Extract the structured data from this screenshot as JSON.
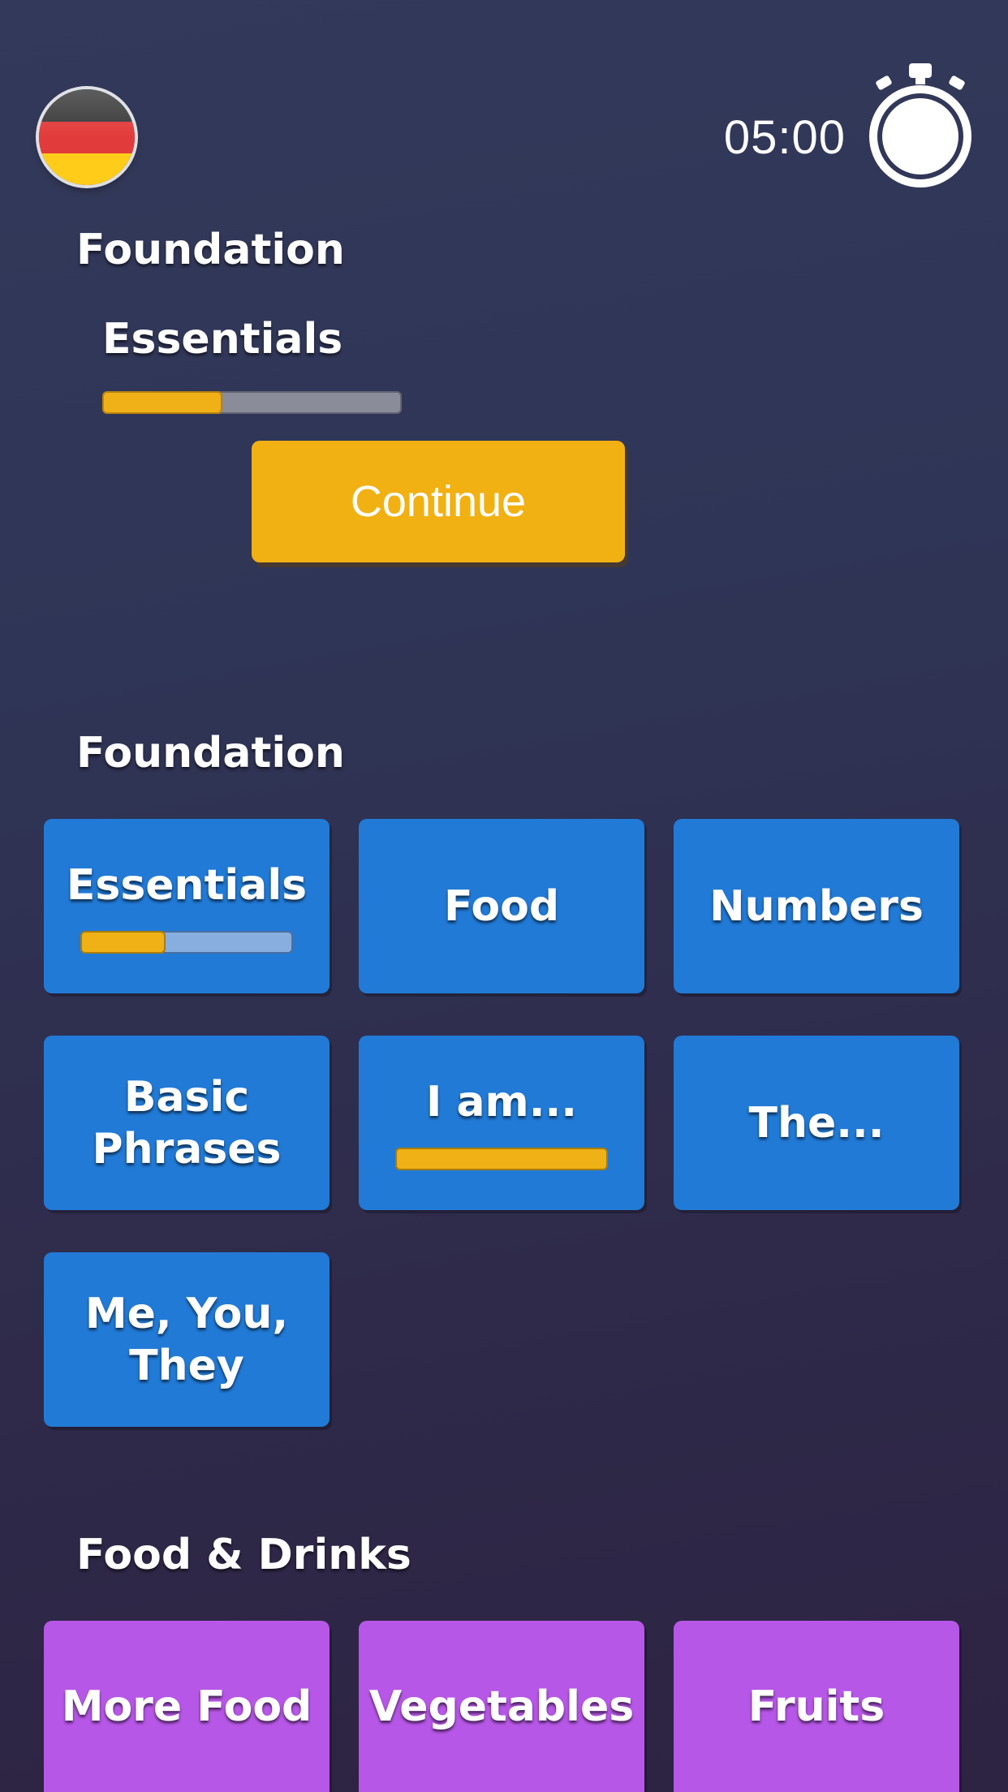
{
  "top_bar": {
    "flag_icon": "germany-flag-icon",
    "timer": "05:00",
    "timer_icon": "stopwatch-icon"
  },
  "current_lesson": {
    "section_title": "Foundation",
    "lesson_title": "Essentials",
    "progress": 0.4,
    "continue_label": "Continue"
  },
  "sections": [
    {
      "title": "Foundation",
      "color": "#217ad6",
      "tiles": [
        {
          "label": "Essentials",
          "progress": 0.4
        },
        {
          "label": "Food"
        },
        {
          "label": "Numbers"
        },
        {
          "label": "Basic\nPhrases"
        },
        {
          "label": "I am...",
          "progress": 1.0
        },
        {
          "label": "The..."
        },
        {
          "label": "Me, You,\nThey"
        }
      ]
    },
    {
      "title": "Food & Drinks",
      "color": "#b757e7",
      "tiles": [
        {
          "label": "More Food"
        },
        {
          "label": "Vegetables"
        },
        {
          "label": "Fruits"
        }
      ]
    }
  ],
  "colors": {
    "accent_yellow": "#f1b113",
    "tile_blue": "#217ad6",
    "tile_purple": "#b757e7"
  }
}
